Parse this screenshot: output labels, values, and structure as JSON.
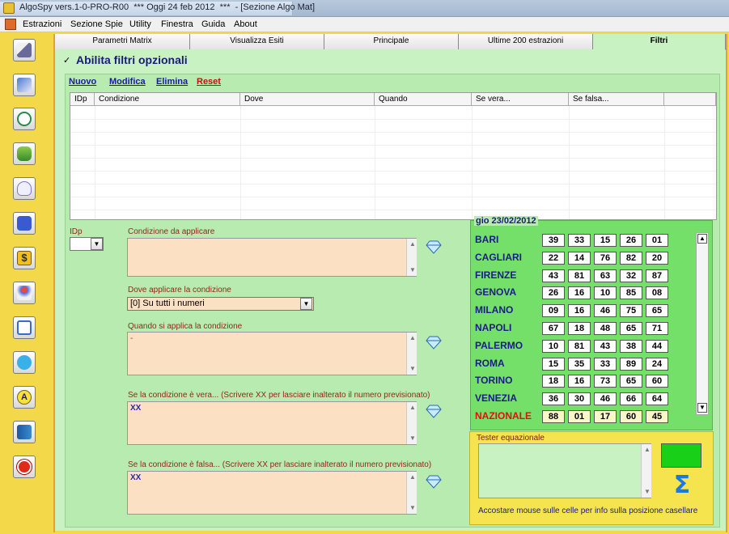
{
  "window": {
    "title": "AlgoSpy vers.1-0-PRO-R00  *** Oggi 24 feb 2012  ***  - [Sezione Algo Mat]"
  },
  "menu": [
    "Estrazioni",
    "Sezione Spie",
    "Utility",
    "Finestra",
    "Guida",
    "About"
  ],
  "sidebar": {
    "icons": [
      "pencil-icon",
      "eraser-icon",
      "compass-icon",
      "binoculars-icon",
      "lightbulb-icon",
      "hand-icon",
      "dollar-icon",
      "pyramid-icon",
      "grid-icon",
      "bucket-icon",
      "letter-a-icon",
      "book-icon",
      "power-icon"
    ]
  },
  "tabs": [
    "Parametri Matrix",
    "Visualizza Esiti",
    "Principale",
    "Ultime 200 estrazioni",
    "Filtri"
  ],
  "filtri": {
    "abilita_label": "Abilita filtri opzionali",
    "abilita_checked": "✓",
    "links": {
      "nuovo": "Nuovo",
      "modifica": "Modifica",
      "elimina": "Elimina",
      "reset": "Reset"
    },
    "grid_headers": [
      "IDp",
      "Condizione",
      "Dove",
      "Quando",
      "Se vera...",
      "Se falsa..."
    ],
    "idp_label": "IDp",
    "condizione_label": "Condizione da applicare",
    "dove_label": "Dove applicare la condizione",
    "dove_value": "[0] Su tutti i numeri",
    "quando_label": "Quando si applica la condizione",
    "quando_value": "-",
    "vera_label": "Se la condizione è vera... (Scrivere XX per lasciare inalterato il numero previsionato)",
    "vera_value": "XX",
    "falsa_label": "Se la condizione è falsa...  (Scrivere XX per lasciare inalterato il numero previsionato)",
    "falsa_value": "XX"
  },
  "estrazione": {
    "date": "gio 23/02/2012",
    "ruote": [
      {
        "name": "BARI",
        "nums": [
          "39",
          "33",
          "15",
          "26",
          "01"
        ]
      },
      {
        "name": "CAGLIARI",
        "nums": [
          "22",
          "14",
          "76",
          "82",
          "20"
        ]
      },
      {
        "name": "FIRENZE",
        "nums": [
          "43",
          "81",
          "63",
          "32",
          "87"
        ]
      },
      {
        "name": "GENOVA",
        "nums": [
          "26",
          "16",
          "10",
          "85",
          "08"
        ]
      },
      {
        "name": "MILANO",
        "nums": [
          "09",
          "16",
          "46",
          "75",
          "65"
        ]
      },
      {
        "name": "NAPOLI",
        "nums": [
          "67",
          "18",
          "48",
          "65",
          "71"
        ]
      },
      {
        "name": "PALERMO",
        "nums": [
          "10",
          "81",
          "43",
          "38",
          "44"
        ]
      },
      {
        "name": "ROMA",
        "nums": [
          "15",
          "35",
          "33",
          "89",
          "24"
        ]
      },
      {
        "name": "TORINO",
        "nums": [
          "18",
          "16",
          "73",
          "65",
          "60"
        ]
      },
      {
        "name": "VENEZIA",
        "nums": [
          "36",
          "30",
          "46",
          "66",
          "64"
        ]
      },
      {
        "name": "NAZIONALE",
        "nums": [
          "88",
          "01",
          "17",
          "60",
          "45"
        ]
      }
    ],
    "nazionale_color": "#e01010"
  },
  "tester": {
    "title": "Tester equazionale",
    "note": "Accostare mouse sulle celle per info sulla posizione casellare",
    "sigma": "Σ"
  }
}
